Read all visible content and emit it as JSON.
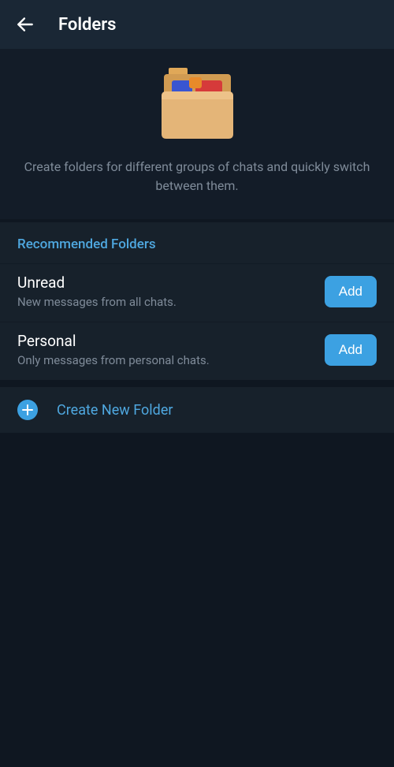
{
  "header": {
    "title": "Folders"
  },
  "intro": {
    "text": "Create folders for different groups of chats and quickly switch between them."
  },
  "recommended": {
    "title": "Recommended Folders",
    "items": [
      {
        "title": "Unread",
        "subtitle": "New messages from all chats.",
        "button": "Add"
      },
      {
        "title": "Personal",
        "subtitle": "Only messages from personal chats.",
        "button": "Add"
      }
    ]
  },
  "create": {
    "label": "Create New Folder"
  }
}
